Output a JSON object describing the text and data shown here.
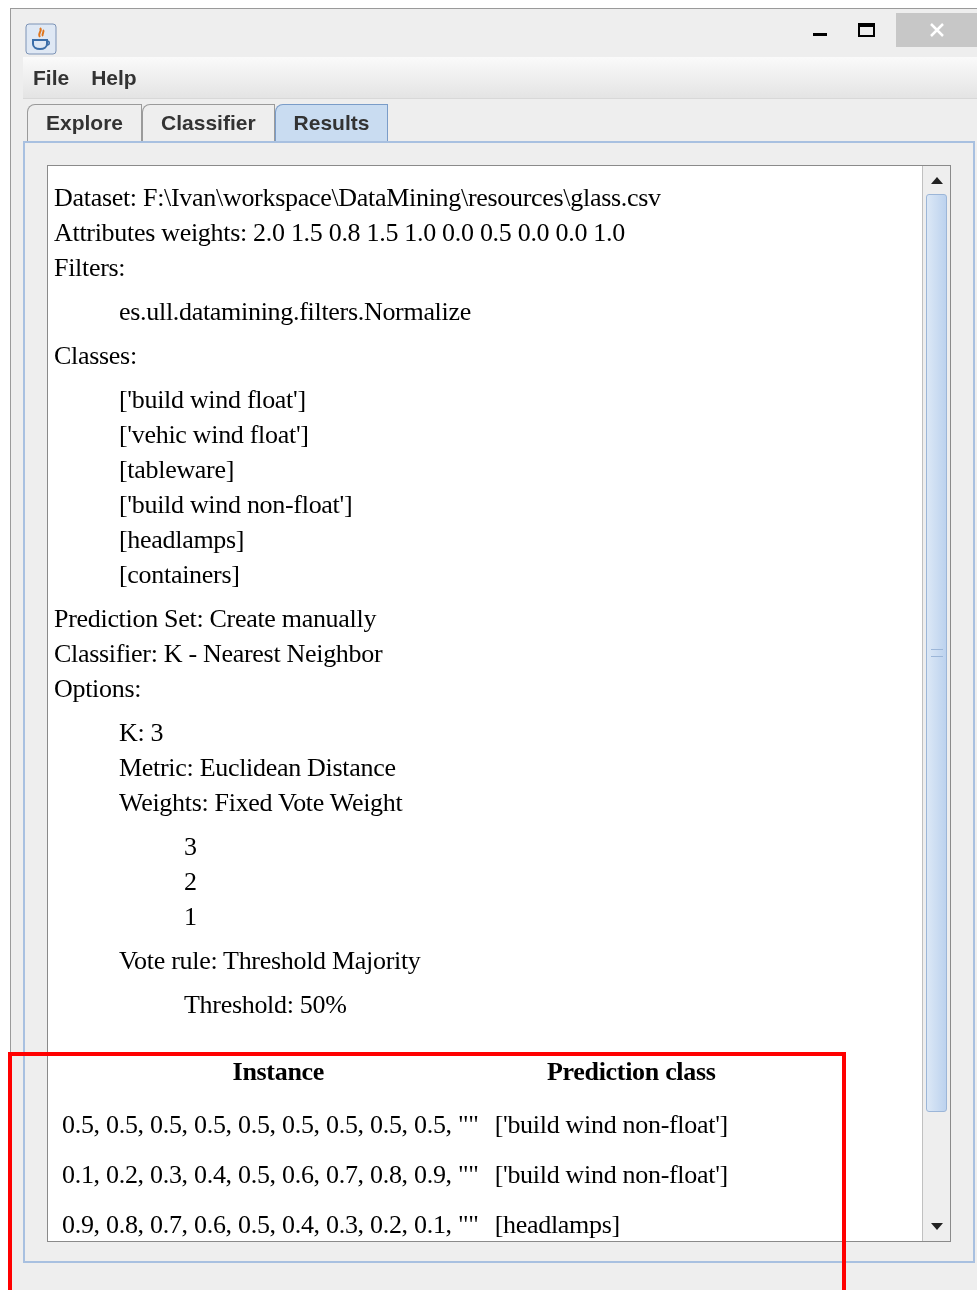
{
  "menu": [
    "File",
    "Help"
  ],
  "tabs": [
    {
      "label": "Explore",
      "selected": false
    },
    {
      "label": "Classifier",
      "selected": false
    },
    {
      "label": "Results",
      "selected": true
    }
  ],
  "report": [
    {
      "text": "Dataset: F:\\Ivan\\workspace\\DataMining\\resources\\glass.csv"
    },
    {
      "text": "Attributes weights: 2.0 1.5 0.8 1.5 1.0 0.0 0.5 0.0 0.0 1.0"
    },
    {
      "text": "Filters:",
      "children": [
        {
          "text": "es.ull.datamining.filters.Normalize"
        }
      ]
    },
    {
      "text": "Classes:",
      "children": [
        {
          "text": "['build wind float']"
        },
        {
          "text": "['vehic wind float']"
        },
        {
          "text": "[tableware]"
        },
        {
          "text": "['build wind non-float']"
        },
        {
          "text": "[headlamps]"
        },
        {
          "text": "[containers]"
        }
      ]
    },
    {
      "text": "Prediction Set: Create manually"
    },
    {
      "text": "Classifier: K - Nearest Neighbor"
    },
    {
      "text": "Options:",
      "children": [
        {
          "text": "K: 3"
        },
        {
          "text": "Metric: Euclidean Distance"
        },
        {
          "text": "Weights: Fixed Vote Weight",
          "children": [
            {
              "text": "3"
            },
            {
              "text": "2"
            },
            {
              "text": "1"
            }
          ]
        },
        {
          "text": "Vote rule: Threshold Majority",
          "children": [
            {
              "text": "Threshold: 50%"
            }
          ]
        }
      ]
    }
  ],
  "table": {
    "columns": [
      "Instance",
      "Prediction class"
    ],
    "rows": [
      [
        "0.5, 0.5, 0.5, 0.5, 0.5, 0.5, 0.5, 0.5, 0.5, \"\"",
        "['build wind non-float']"
      ],
      [
        "0.1, 0.2, 0.3, 0.4, 0.5, 0.6, 0.7, 0.8, 0.9, \"\"",
        "['build wind non-float']"
      ],
      [
        "0.9, 0.8, 0.7, 0.6, 0.5, 0.4, 0.3, 0.2, 0.1, \"\"",
        "[headlamps]"
      ]
    ]
  }
}
